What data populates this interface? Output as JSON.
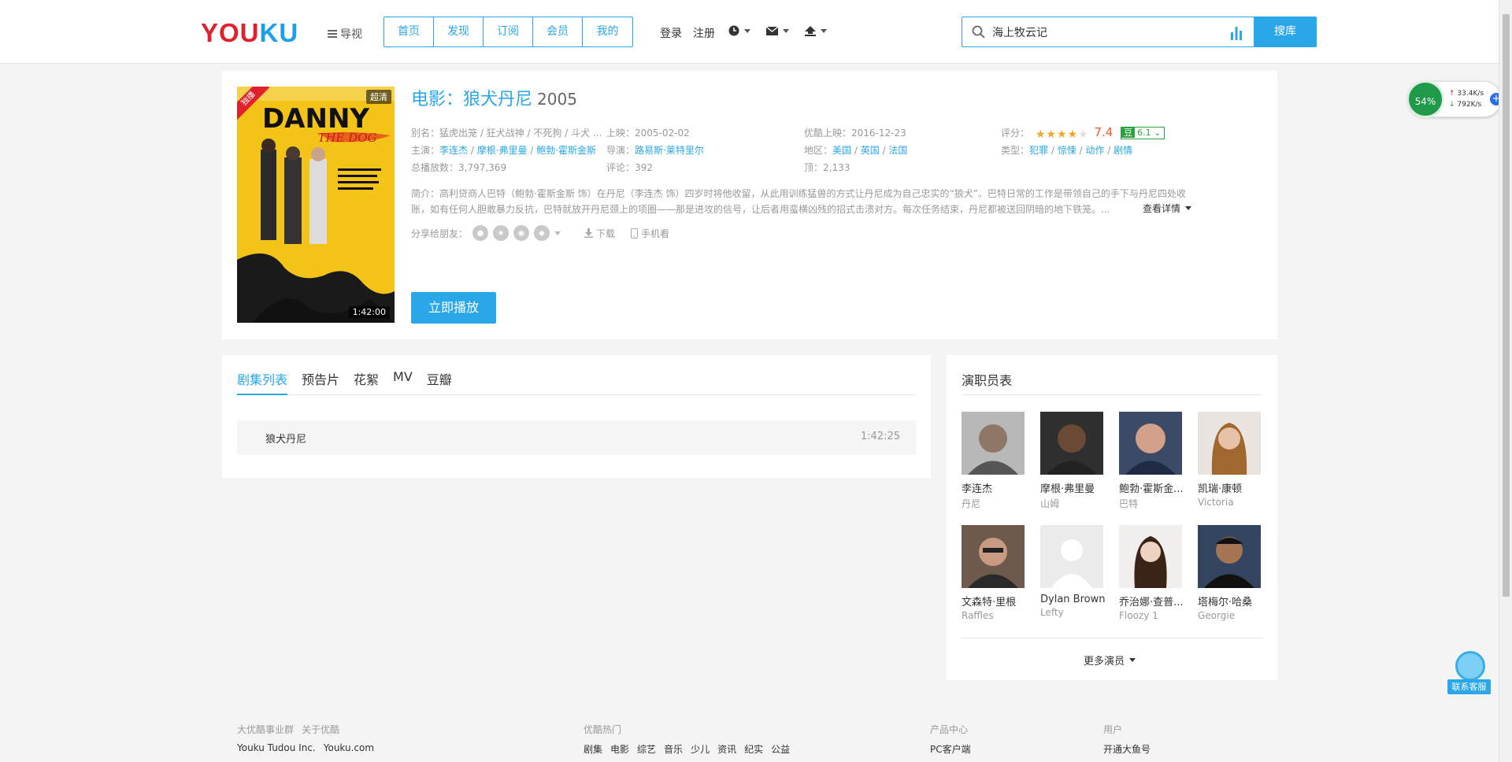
{
  "header": {
    "logo": {
      "part1": "YOU",
      "part2": "KU"
    },
    "guide_label": "导视",
    "nav": [
      "首页",
      "发现",
      "订阅",
      "会员",
      "我的"
    ],
    "login": "登录",
    "register": "注册",
    "search_value": "海上牧云记",
    "search_button": "搜库"
  },
  "detail": {
    "poster": {
      "title_big": "DANNY",
      "title_small": "THE DOG",
      "exclusive": "独播",
      "quality": "超清",
      "duration": "1:42:00"
    },
    "category": "电影：",
    "title": "狼犬丹尼",
    "year": "2005",
    "alias": "别名：猛虎出笼 / 狂犬战神 / 不死狗 / 斗犬 ...",
    "release_label": "上映：",
    "release": "2005-02-02",
    "youku_release": "优酷上映：2016-12-23",
    "rating_label": "评分：",
    "rating": "7.4",
    "douban_icon": "豆",
    "douban": "6.1",
    "stars_label": "主演：",
    "stars": [
      "李连杰",
      "摩根·弗里曼",
      "鲍勃·霍斯金斯"
    ],
    "director_label": "导演：",
    "director": "路易斯·莱特里尔",
    "region_label": "地区：",
    "regions": [
      "美国",
      "英国",
      "法国"
    ],
    "genre_label": "类型：",
    "genres": [
      "犯罪",
      "惊悚",
      "动作",
      "剧情"
    ],
    "plays": "总播放数：3,797,369",
    "comments": "评论：392",
    "likes": "顶：2,133",
    "intro": "简介：高利贷商人巴特（鲍勃·霍斯金斯 饰）在丹尼（李连杰 饰）四岁时将他收留，从此用训练猛兽的方式让丹尼成为自己忠实的“狼犬”。巴特日常的工作是带领自己的手下与丹尼四处收账，如有任何人胆敢暴力反抗，巴特就放开丹尼颈上的项圈——那是进攻的信号，让后者用蛮横凶残的招式击溃对方。每次任务结束，丹尼都被送回阴暗的地下铁笼。...",
    "more_detail": "查看详情",
    "share_label": "分享给朋友：",
    "download": "下载",
    "mobile": "手机看",
    "play_button": "立即播放"
  },
  "episodes": {
    "tabs": [
      "剧集列表",
      "预告片",
      "花絮",
      "MV",
      "豆瓣"
    ],
    "items": [
      {
        "name": "狼犬丹尼",
        "duration": "1:42:25"
      }
    ]
  },
  "cast": {
    "title": "演职员表",
    "members": [
      {
        "name": "李连杰",
        "role": "丹尼"
      },
      {
        "name": "摩根·弗里曼",
        "role": "山姆"
      },
      {
        "name": "鲍勃·霍斯金...",
        "role": "巴特"
      },
      {
        "name": "凯瑞·康顿",
        "role": "Victoria"
      },
      {
        "name": "文森特·里根",
        "role": "Raffles"
      },
      {
        "name": "Dylan Brown",
        "role": "Lefty"
      },
      {
        "name": "乔治娜·查普...",
        "role": "Floozy 1"
      },
      {
        "name": "塔梅尔·哈桑",
        "role": "Georgie"
      }
    ],
    "more": "更多演员"
  },
  "footer": {
    "col1_head": [
      "大优酷事业群",
      "关于优酷"
    ],
    "col1_links": [
      "Youku Tudou Inc.",
      "Youku.com"
    ],
    "col2_head": "优酷热门",
    "col2_links": [
      "剧集",
      "电影",
      "综艺",
      "音乐",
      "少儿",
      "资讯",
      "纪实",
      "公益"
    ],
    "col3_head": "产品中心",
    "col3_links": [
      "PC客户端"
    ],
    "col4_head": "用户",
    "col4_links": [
      "开通大鱼号"
    ]
  },
  "widgets": {
    "net_percent": "54%",
    "upload": "33.4K/s",
    "download": "792K/s",
    "service": "联系客服"
  },
  "colors": {
    "accent": "#2aa7e8",
    "brand_red": "#e0212d",
    "score": "#f05a23",
    "douban": "#2aa33f"
  }
}
